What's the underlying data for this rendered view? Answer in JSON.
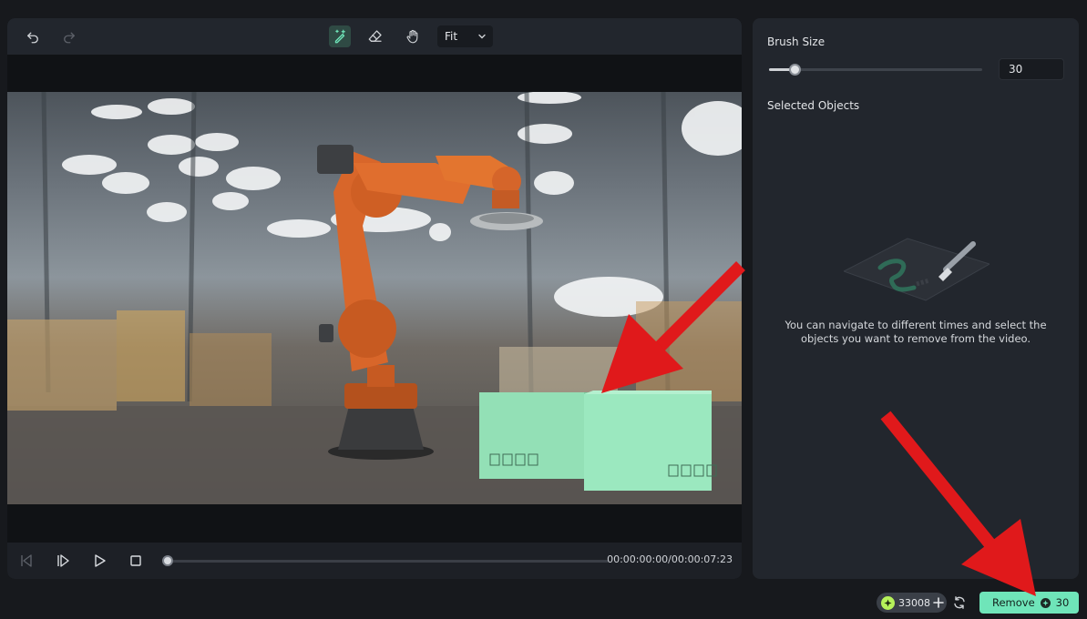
{
  "toolbar": {
    "zoom_selected": "Fit",
    "icons": [
      "undo-icon",
      "redo-icon",
      "smart-brush-icon",
      "eraser-icon",
      "hand-icon",
      "chevron-down-icon"
    ]
  },
  "player": {
    "timecode": "00:00:00:00/00:00:07:23",
    "progress": 0,
    "icons": [
      "prev-frame-icon",
      "next-frame-icon",
      "play-icon",
      "stop-icon"
    ]
  },
  "side_panel": {
    "brush_size_label": "Brush Size",
    "brush_size_value": "30",
    "brush_size_level": 0.12,
    "selected_objects_label": "Selected Objects",
    "empty_message": "You can navigate to different times and select the objects you want to remove from the video."
  },
  "footer": {
    "credits": "33008",
    "remove_label": "Remove",
    "remove_cost": "30"
  },
  "colors": {
    "accent": "#6fe5b9",
    "credit_coin": "#b6f25a",
    "annotation_red": "#e0191b",
    "panel_bg": "#22262d",
    "app_bg": "#17191d"
  }
}
